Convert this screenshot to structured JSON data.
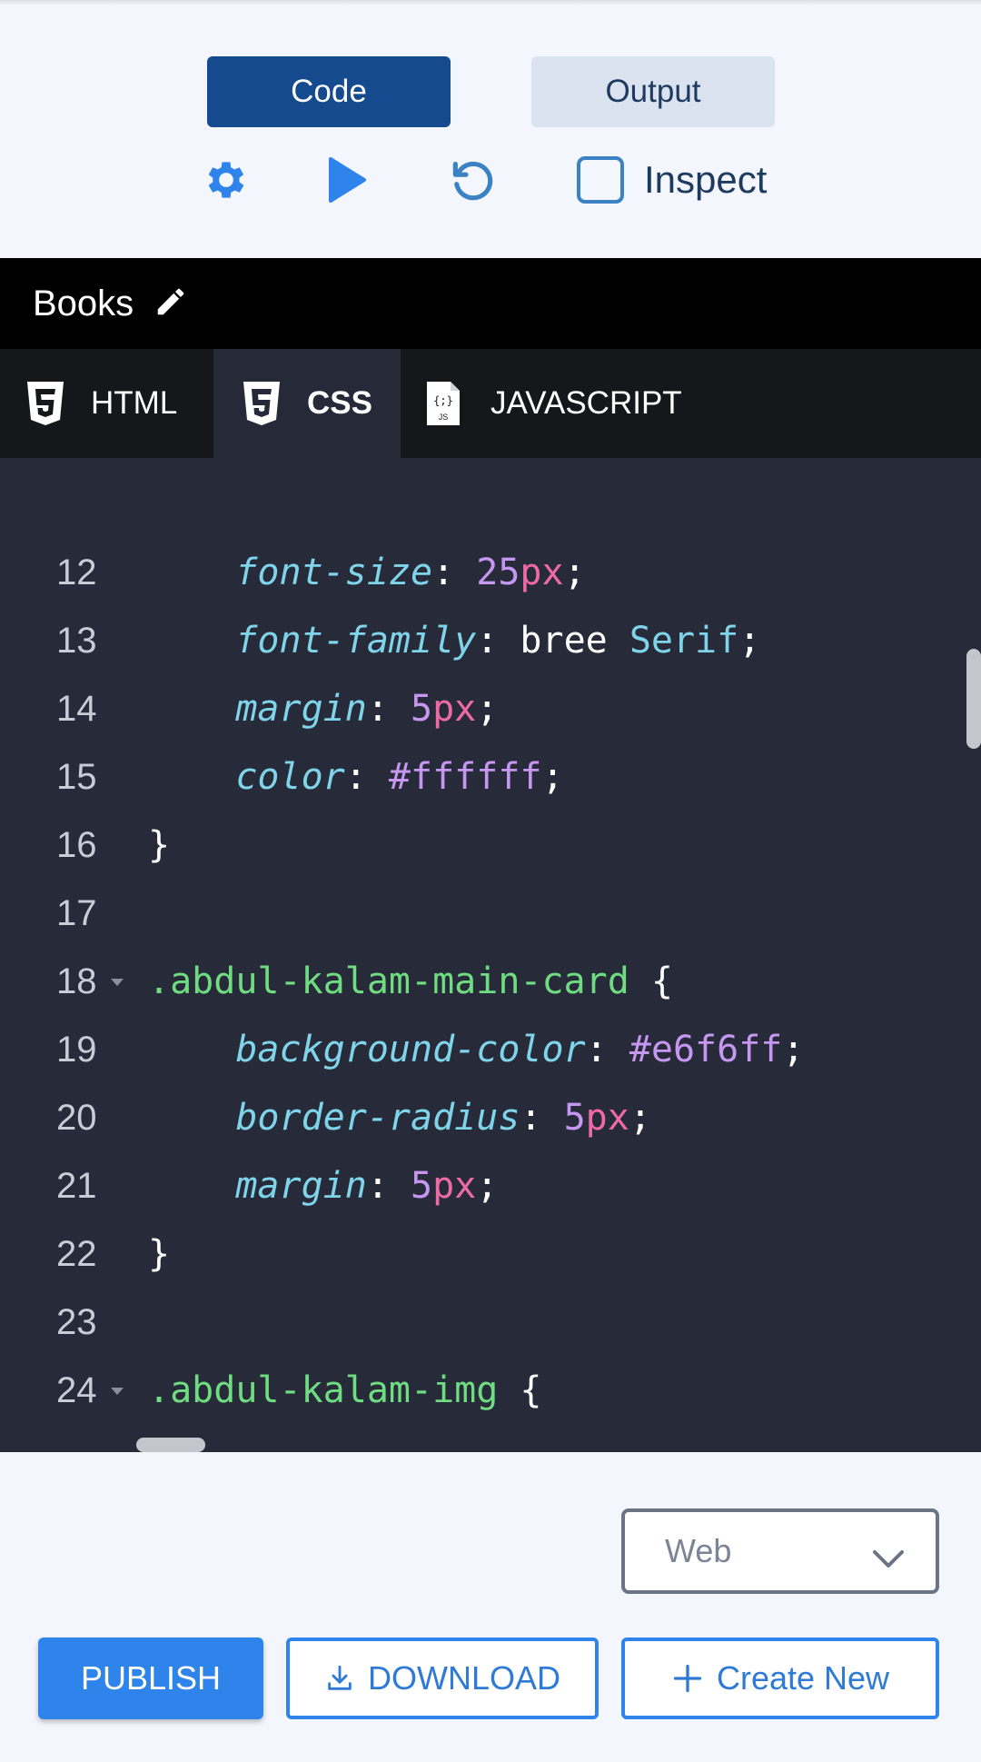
{
  "toolbar": {
    "code_label": "Code",
    "output_label": "Output",
    "inspect_label": "Inspect"
  },
  "project": {
    "title": "Books"
  },
  "tabs": [
    {
      "label": "HTML",
      "icon": "html5-icon"
    },
    {
      "label": "CSS",
      "icon": "css3-icon",
      "active": true
    },
    {
      "label": "JAVASCRIPT",
      "icon": "js-file-icon"
    }
  ],
  "editor": {
    "lines": [
      {
        "n": "12",
        "tokens": [
          {
            "t": "    "
          },
          {
            "t": "font-size",
            "c": "prop"
          },
          {
            "t": ": ",
            "c": "plain"
          },
          {
            "t": "25",
            "c": "num"
          },
          {
            "t": "px",
            "c": "unit"
          },
          {
            "t": ";",
            "c": "plain"
          }
        ]
      },
      {
        "n": "13",
        "tokens": [
          {
            "t": "    "
          },
          {
            "t": "font-family",
            "c": "prop"
          },
          {
            "t": ": bree ",
            "c": "plain"
          },
          {
            "t": "Serif",
            "c": "id"
          },
          {
            "t": ";",
            "c": "plain"
          }
        ]
      },
      {
        "n": "14",
        "tokens": [
          {
            "t": "    "
          },
          {
            "t": "margin",
            "c": "prop"
          },
          {
            "t": ": ",
            "c": "plain"
          },
          {
            "t": "5",
            "c": "num"
          },
          {
            "t": "px",
            "c": "unit"
          },
          {
            "t": ";",
            "c": "plain"
          }
        ]
      },
      {
        "n": "15",
        "tokens": [
          {
            "t": "    "
          },
          {
            "t": "color",
            "c": "prop"
          },
          {
            "t": ": ",
            "c": "plain"
          },
          {
            "t": "#ffffff",
            "c": "num"
          },
          {
            "t": ";",
            "c": "plain"
          }
        ]
      },
      {
        "n": "16",
        "tokens": [
          {
            "t": "}",
            "c": "plain"
          }
        ]
      },
      {
        "n": "17",
        "tokens": []
      },
      {
        "n": "18",
        "fold": true,
        "tokens": [
          {
            "t": ".abdul-kalam-main-card",
            "c": "sel"
          },
          {
            "t": " {",
            "c": "plain"
          }
        ]
      },
      {
        "n": "19",
        "tokens": [
          {
            "t": "    "
          },
          {
            "t": "background-color",
            "c": "prop"
          },
          {
            "t": ": ",
            "c": "plain"
          },
          {
            "t": "#e6f6ff",
            "c": "num"
          },
          {
            "t": ";",
            "c": "plain"
          }
        ]
      },
      {
        "n": "20",
        "tokens": [
          {
            "t": "    "
          },
          {
            "t": "border-radius",
            "c": "prop"
          },
          {
            "t": ": ",
            "c": "plain"
          },
          {
            "t": "5",
            "c": "num"
          },
          {
            "t": "px",
            "c": "unit"
          },
          {
            "t": ";",
            "c": "plain"
          }
        ]
      },
      {
        "n": "21",
        "tokens": [
          {
            "t": "    "
          },
          {
            "t": "margin",
            "c": "prop"
          },
          {
            "t": ": ",
            "c": "plain"
          },
          {
            "t": "5",
            "c": "num"
          },
          {
            "t": "px",
            "c": "unit"
          },
          {
            "t": ";",
            "c": "plain"
          }
        ]
      },
      {
        "n": "22",
        "tokens": [
          {
            "t": "}",
            "c": "plain"
          }
        ]
      },
      {
        "n": "23",
        "tokens": []
      },
      {
        "n": "24",
        "fold": true,
        "tokens": [
          {
            "t": ".abdul-kalam-img",
            "c": "sel"
          },
          {
            "t": " {",
            "c": "plain"
          }
        ]
      }
    ]
  },
  "bottom": {
    "device_select": "Web",
    "publish_label": "PUBLISH",
    "download_label": "DOWNLOAD",
    "create_label": "Create New"
  },
  "colors": {
    "primary": "#164a8e",
    "accent": "#2e84ea",
    "editor_bg": "#272a38"
  }
}
